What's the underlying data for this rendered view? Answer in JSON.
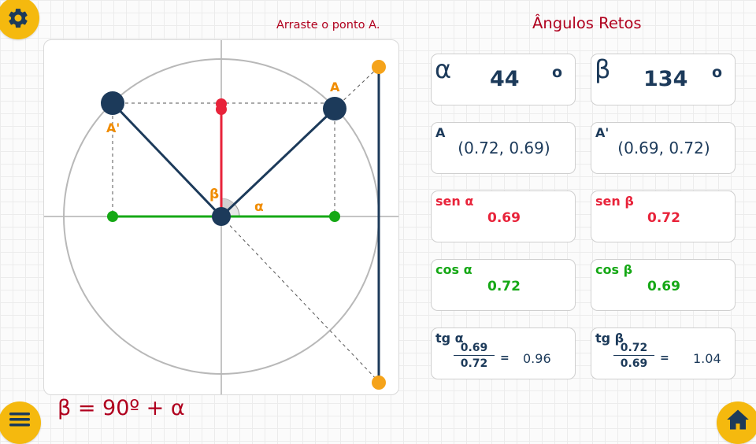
{
  "instruction": "Arraste o ponto A.",
  "title": "Ângulos Retos",
  "formula": "β = 90º +  α",
  "canvas": {
    "label_A": "A",
    "label_A_prime": "A'",
    "label_alpha": "α",
    "label_beta": "β"
  },
  "cards": {
    "alpha": {
      "symbol": "α",
      "value": "44",
      "unit": "o"
    },
    "beta": {
      "symbol": "β",
      "value": "134",
      "unit": "o"
    },
    "point_a": {
      "label": "A",
      "value": "(0.72, 0.69)"
    },
    "point_a_prime": {
      "label": "A'",
      "value": "(0.69, 0.72)"
    },
    "sen_alpha": {
      "label": "sen α",
      "value": "0.69"
    },
    "sen_beta": {
      "label": "sen β",
      "value": "0.72"
    },
    "cos_alpha": {
      "label": "cos α",
      "value": "0.72"
    },
    "cos_beta": {
      "label": "cos β",
      "value": "0.69"
    },
    "tg_alpha": {
      "label": "tg α",
      "num": "0.69",
      "den": "0.72",
      "eq": "=",
      "result": "0.96"
    },
    "tg_beta": {
      "label": "tg β",
      "num": "0.72",
      "den": "0.69",
      "eq": "=",
      "result": "1.04"
    }
  },
  "colors": {
    "accent": "#f5b90e",
    "title": "#b0001e",
    "navy": "#1c3a5a",
    "red": "#e8233a",
    "green": "#16a816",
    "orange": "#f08c00"
  },
  "icons": {
    "settings": "gear-icon",
    "menu": "hamburger-menu-icon",
    "home": "home-icon"
  }
}
